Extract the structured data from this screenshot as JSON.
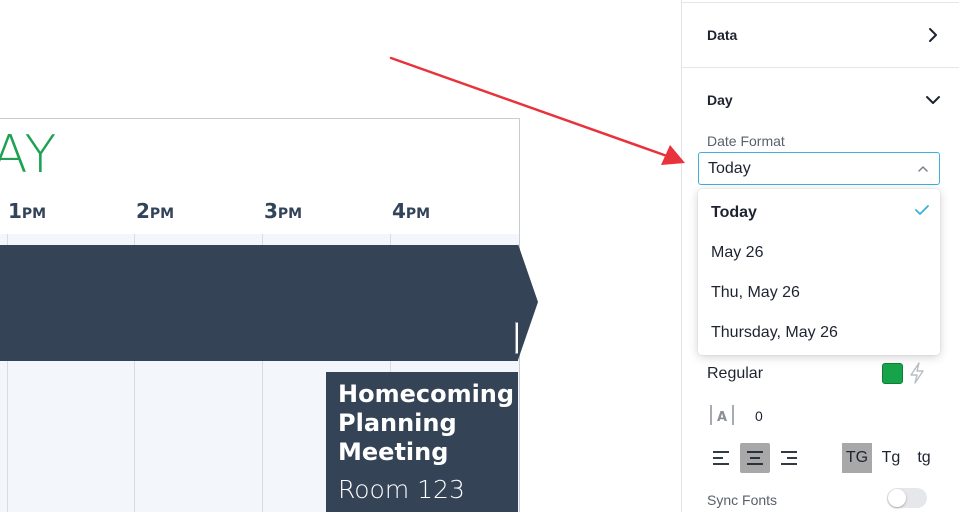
{
  "preview": {
    "title_fragment": "AY",
    "hours": [
      {
        "num": "1",
        "ampm": "PM"
      },
      {
        "num": "2",
        "ampm": "PM"
      },
      {
        "num": "3",
        "ampm": "PM"
      },
      {
        "num": "4",
        "ampm": "PM"
      }
    ],
    "event": {
      "title": "Homecoming\nPlanning\nMeeting",
      "room": "Room 123"
    }
  },
  "panel": {
    "data_section": {
      "title": "Data"
    },
    "day_section": {
      "title": "Day"
    },
    "date_format": {
      "label": "Date Format",
      "value": "Today",
      "options": [
        "Today",
        "May 26",
        "Thu, May 26",
        "Thursday, May 26"
      ],
      "selected_index": 0
    },
    "font_weight": "Regular",
    "text_color": "#17a34a",
    "letter_spacing": "0",
    "case_options": [
      "TG",
      "Tg",
      "tg"
    ],
    "sync_fonts": {
      "label": "Sync Fonts",
      "enabled": false
    }
  },
  "colors": {
    "accent": "#3fb0d9",
    "banner": "#344356",
    "title_green": "#1ea154",
    "arrow_red": "#e8323c"
  }
}
